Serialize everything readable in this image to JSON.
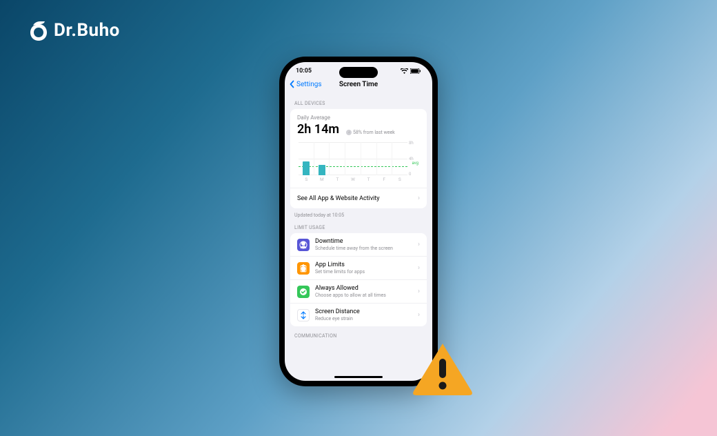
{
  "logo_text": "Dr.Buho",
  "statusbar": {
    "time": "10:05"
  },
  "nav": {
    "back": "Settings",
    "title": "Screen Time"
  },
  "sections": {
    "all_devices": "ALL DEVICES",
    "limit_usage": "LIMIT USAGE",
    "communication": "COMMUNICATION"
  },
  "daily_average": {
    "label": "Daily Average",
    "value": "2h 14m",
    "delta": "58% from last week"
  },
  "chart_data": {
    "type": "bar",
    "categories": [
      "S",
      "M",
      "T",
      "W",
      "T",
      "F",
      "S"
    ],
    "values": [
      3.3,
      2.5,
      0,
      0,
      0,
      0,
      0
    ],
    "ylabel": "",
    "ylim": [
      0,
      8
    ],
    "yticks": [
      {
        "v": 8,
        "label": "8h"
      },
      {
        "v": 4,
        "label": "4h"
      },
      {
        "v": 0,
        "label": "0"
      }
    ],
    "avg_line": 2.23,
    "avg_label": "avg"
  },
  "see_all": "See All App & Website Activity",
  "updated": "Updated today at 10:05",
  "limit_items": [
    {
      "id": "downtime",
      "title": "Downtime",
      "sub": "Schedule time away from the screen",
      "color": "#5856d6"
    },
    {
      "id": "applimits",
      "title": "App Limits",
      "sub": "Set time limits for apps",
      "color": "#ff9500"
    },
    {
      "id": "always",
      "title": "Always Allowed",
      "sub": "Choose apps to allow at all times",
      "color": "#34c759"
    },
    {
      "id": "distance",
      "title": "Screen Distance",
      "sub": "Reduce eye strain",
      "color": "#ffffff"
    }
  ]
}
